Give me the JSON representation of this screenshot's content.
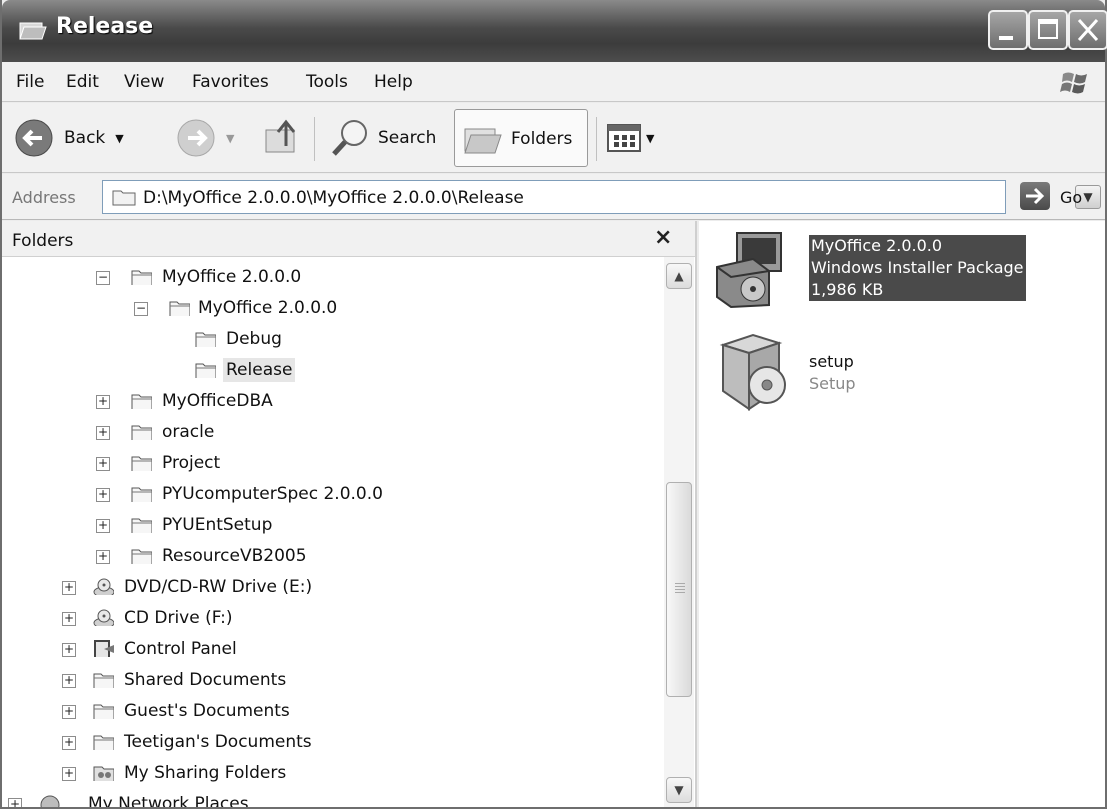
{
  "window": {
    "title": "Release"
  },
  "menu": [
    "File",
    "Edit",
    "View",
    "Favorites",
    "Tools",
    "Help"
  ],
  "toolbar": {
    "back_label": "Back",
    "search_label": "Search",
    "folders_label": "Folders"
  },
  "address": {
    "label": "Address",
    "value": "D:\\MyOffice 2.0.0.0\\MyOffice 2.0.0.0\\Release",
    "go_label": "Go"
  },
  "folder_pane": {
    "title": "Folders",
    "close_glyph": "×",
    "tree": [
      {
        "label": "MyOffice 2.0.0.0",
        "expander": "−"
      },
      {
        "label": "MyOffice 2.0.0.0",
        "expander": "−"
      },
      {
        "label": "Debug",
        "expander": ""
      },
      {
        "label": "Release",
        "expander": "",
        "selected": true
      },
      {
        "label": "MyOfficeDBA",
        "expander": "+"
      },
      {
        "label": "oracle",
        "expander": "+"
      },
      {
        "label": "Project",
        "expander": "+"
      },
      {
        "label": "PYUcomputerSpec 2.0.0.0",
        "expander": "+"
      },
      {
        "label": "PYUEntSetup",
        "expander": "+"
      },
      {
        "label": "ResourceVB2005",
        "expander": "+"
      },
      {
        "label": "DVD/CD-RW Drive (E:)",
        "expander": "+",
        "icon": "dvd-drive-icon"
      },
      {
        "label": "CD Drive (F:)",
        "expander": "+",
        "icon": "cd-drive-icon"
      },
      {
        "label": "Control Panel",
        "expander": "+",
        "icon": "control-panel-icon"
      },
      {
        "label": "Shared Documents",
        "expander": "+"
      },
      {
        "label": "Guest's Documents",
        "expander": "+"
      },
      {
        "label": "Teetigan's Documents",
        "expander": "+"
      },
      {
        "label": "My Sharing Folders",
        "expander": "+",
        "icon": "sharing-folder-icon"
      },
      {
        "label": "My Network Places",
        "expander": "+",
        "icon": "network-places-icon"
      }
    ]
  },
  "files": [
    {
      "name": "MyOffice 2.0.0.0",
      "type": "Windows Installer Package",
      "size": "1,986 KB",
      "selected": true,
      "icon": "installer-package-icon"
    },
    {
      "name": "setup",
      "type": "Setup",
      "icon": "setup-icon"
    }
  ]
}
